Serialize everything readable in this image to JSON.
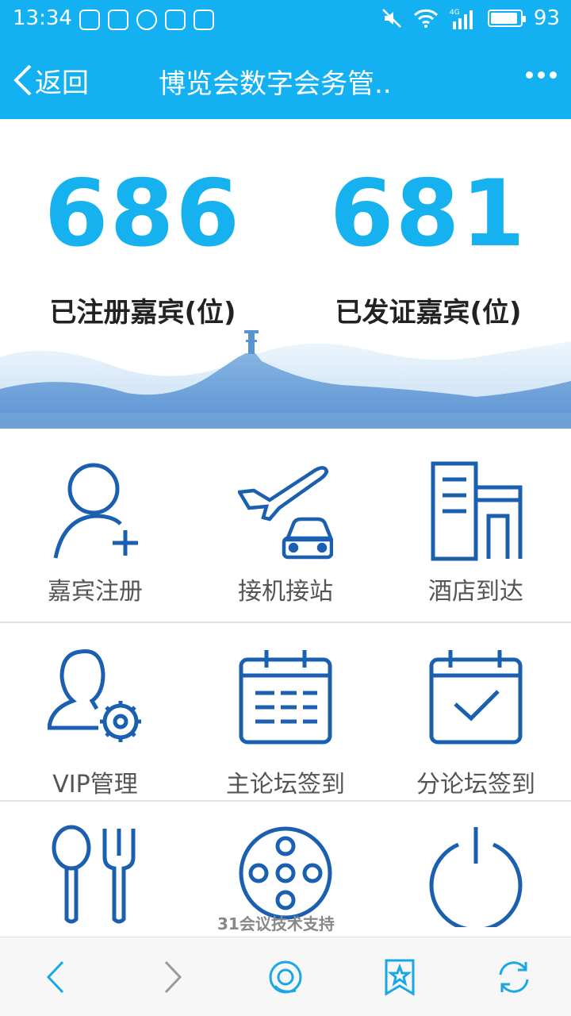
{
  "status_bar": {
    "time": "13:34",
    "battery_level": "93",
    "battery_fraction": 0.93,
    "network": "4G",
    "left_icons": [
      "weibo-icon",
      "shield-icon",
      "q-browser-icon",
      "qq-icon",
      "image-icon"
    ],
    "right_icons": [
      "mute-icon",
      "wifi-icon",
      "signal-icon",
      "battery-icon"
    ]
  },
  "navbar": {
    "back_label": "返回",
    "title": "博览会数字会务管..",
    "more_icon": "more-dots-icon"
  },
  "stats": [
    {
      "value": "686",
      "label": "已注册嘉宾(位)"
    },
    {
      "value": "681",
      "label": "已发证嘉宾(位)"
    }
  ],
  "tiles": [
    {
      "label": "嘉宾注册",
      "icon": "add-user-icon"
    },
    {
      "label": "接机接站",
      "icon": "plane-car-icon"
    },
    {
      "label": "酒店到达",
      "icon": "building-icon"
    },
    {
      "label": "VIP管理",
      "icon": "user-gear-icon"
    },
    {
      "label": "主论坛签到",
      "icon": "calendar-list-icon"
    },
    {
      "label": "分论坛签到",
      "icon": "calendar-check-icon"
    },
    {
      "label": "",
      "icon": "spoon-fork-icon"
    },
    {
      "label": "",
      "icon": "film-reel-icon"
    },
    {
      "label": "",
      "icon": "power-icon"
    }
  ],
  "watermark": "31会议技术支持",
  "bottom_bar": [
    "back-arrow-icon",
    "forward-arrow-icon",
    "browser-home-icon",
    "bookmark-star-icon",
    "refresh-icon"
  ],
  "colors": {
    "primary": "#13b1f2",
    "stat_number": "#16b2ef",
    "icon_stroke": "#1b5fb0"
  }
}
